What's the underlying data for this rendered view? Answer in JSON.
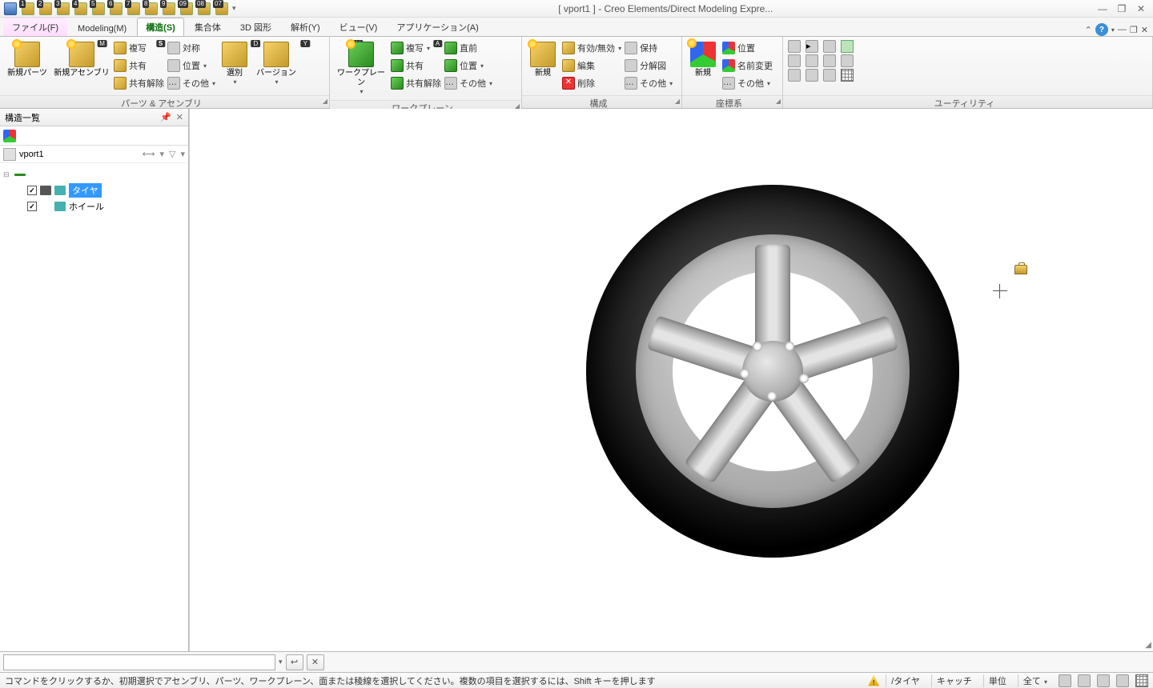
{
  "title": "[ vport1 ] - Creo Elements/Direct Modeling Expre...",
  "quick_access": [
    "1",
    "2",
    "3",
    "4",
    "5",
    "6",
    "7",
    "8",
    "9",
    "09",
    "08",
    "07"
  ],
  "menu": {
    "file": {
      "label": "ファイル(F)",
      "key": "M"
    },
    "modeling": {
      "label": "Modeling(M)"
    },
    "structure": {
      "label": "構造(S)",
      "key": "S"
    },
    "assembly": {
      "label": "集合体",
      "key": "D"
    },
    "shape3d": {
      "label": "3D 図形"
    },
    "analysis": {
      "label": "解析(Y)",
      "key": "Y"
    },
    "view": {
      "label": "ビュー(V)",
      "key": "V"
    },
    "application": {
      "label": "アプリケーション(A)",
      "key": "A"
    }
  },
  "ribbon": {
    "group1": {
      "label": "パーツ & アセンブリ",
      "new_part": "新規パーツ",
      "new_assembly": "新規アセンブリ",
      "copy": "複写",
      "share": "共有",
      "unshare": "共有解除",
      "symmetry": "対称",
      "position": "位置",
      "other": "その他",
      "select": "選別",
      "version": "バージョン"
    },
    "group2": {
      "label": "ワークプレーン",
      "workplane": "ワークプレーン",
      "copy": "複写",
      "share": "共有",
      "unshare": "共有解除",
      "front": "直前",
      "position": "位置",
      "other": "その他"
    },
    "group3": {
      "label": "構成",
      "new": "新規",
      "enable_disable": "有効/無効",
      "edit": "編集",
      "delete": "削除",
      "keep": "保持",
      "exploded": "分解図",
      "other": "その他"
    },
    "group4": {
      "label": "座標系",
      "new": "新規",
      "position": "位置",
      "rename": "名前変更",
      "other": "その他"
    },
    "group5": {
      "label": "ユーティリティ"
    }
  },
  "panel": {
    "title": "構造一覧",
    "vport": "vport1",
    "tree": {
      "root": "",
      "tire": "タイヤ",
      "wheel": "ホイール"
    }
  },
  "cmd": {},
  "status": {
    "message": "コマンドをクリックするか、初期選択でアセンブリ、パーツ、ワークプレーン、面または稜線を選択してください。複数の項目を選択するには、Shift キーを押します",
    "path": "/タイヤ",
    "catch": "キャッチ",
    "unit": "単位",
    "all": "全て"
  }
}
